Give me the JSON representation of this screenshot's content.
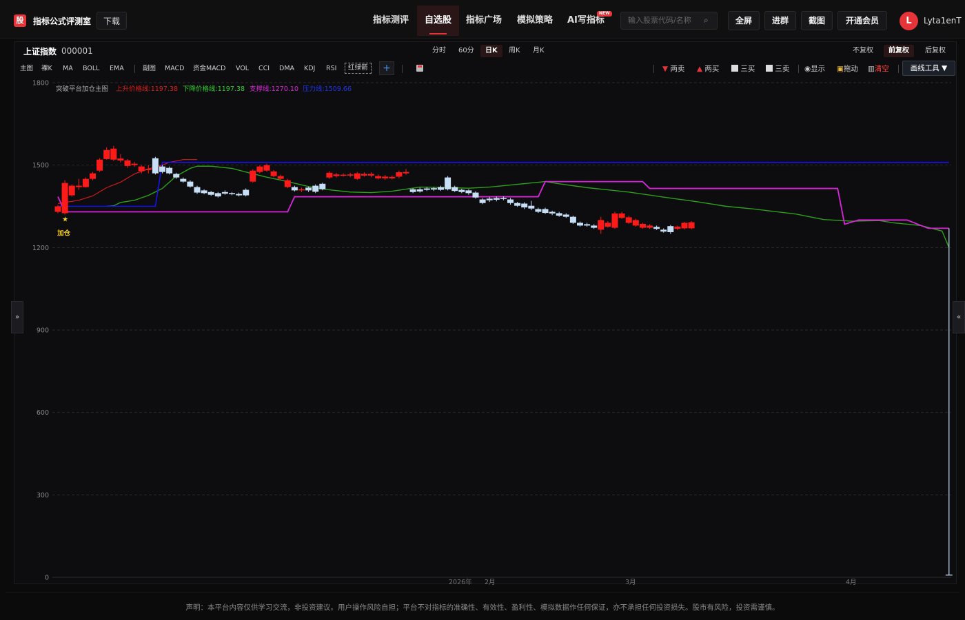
{
  "header": {
    "logo_char": "股",
    "logo_text": "指标公式评测室",
    "download_label": "下载",
    "nav": [
      {
        "label": "指标测评",
        "active": false
      },
      {
        "label": "自选股",
        "active": true
      },
      {
        "label": "指标广场",
        "active": false
      },
      {
        "label": "模拟策略",
        "active": false
      },
      {
        "label": "AI写指标",
        "active": false
      }
    ],
    "new_badge": "NEW",
    "search_placeholder": "输入股票代码/名称",
    "fullscreen_label": "全屏",
    "join_group_label": "进群",
    "screenshot_label": "截图",
    "vip_label": "开通会员",
    "avatar_letter": "L",
    "username": "Lyta1enT"
  },
  "stock": {
    "name": "上证指数",
    "code": "000001"
  },
  "periods": [
    {
      "label": "分时",
      "active": false
    },
    {
      "label": "60分",
      "active": false
    },
    {
      "label": "日K",
      "active": true
    },
    {
      "label": "周K",
      "active": false
    },
    {
      "label": "月K",
      "active": false
    }
  ],
  "adjust": [
    {
      "label": "不复权",
      "active": false
    },
    {
      "label": "前复权",
      "active": true
    },
    {
      "label": "后复权",
      "active": false
    }
  ],
  "indicators_main": [
    "主图",
    "裸K",
    "MA",
    "BOLL",
    "EMA"
  ],
  "indicators_sub": [
    "副图",
    "MACD",
    "资金MACD",
    "VOL",
    "CCI",
    "DMA",
    "KDJ",
    "RSI"
  ],
  "indicator_boxed": "红绿箭",
  "plus_label": "+",
  "tools": {
    "sell2": "两卖",
    "buy2": "两买",
    "buy3": "三买",
    "sell3": "三卖",
    "show": "显示",
    "drag": "拖动",
    "clear": "清空",
    "draw_tool": "画线工具 ▼"
  },
  "side_left": "»",
  "side_right": "«",
  "chart_data": {
    "type": "candlestick",
    "legend": {
      "name": "突破平台加仓主图",
      "up_price": "上升价格线:1197.38",
      "down_price": "下降价格线:1197.38",
      "support": "支撑线:1270.10",
      "pressure": "压力线:1509.66"
    },
    "y_ticks": [
      "1800",
      "1500",
      "1200",
      "900",
      "600",
      "300",
      "0"
    ],
    "ylim": [
      0,
      1800
    ],
    "x_labels": [
      "2026年",
      "2月",
      "3月",
      "4月"
    ],
    "annotation": {
      "label": "加仓",
      "star": "★",
      "index": 1
    },
    "colors": {
      "up": "#ff1a1a",
      "down": "#c7def7",
      "red_line": "#d21a1a",
      "green_line": "#2e9f1a",
      "blue_line": "#1414ee",
      "magenta_line": "#dd22dd",
      "grid": "#2a2a2c"
    },
    "candles": [
      {
        "o": 1330,
        "c": 1350,
        "h": 1355,
        "l": 1325
      },
      {
        "o": 1325,
        "c": 1435,
        "h": 1445,
        "l": 1320
      },
      {
        "o": 1390,
        "c": 1425,
        "h": 1430,
        "l": 1385
      },
      {
        "o": 1420,
        "c": 1425,
        "h": 1450,
        "l": 1410
      },
      {
        "o": 1420,
        "c": 1450,
        "h": 1455,
        "l": 1418
      },
      {
        "o": 1450,
        "c": 1470,
        "h": 1475,
        "l": 1445
      },
      {
        "o": 1480,
        "c": 1520,
        "h": 1525,
        "l": 1475
      },
      {
        "o": 1522,
        "c": 1555,
        "h": 1565,
        "l": 1520
      },
      {
        "o": 1520,
        "c": 1560,
        "h": 1570,
        "l": 1515
      },
      {
        "o": 1517,
        "c": 1524,
        "h": 1540,
        "l": 1510
      },
      {
        "o": 1497,
        "c": 1517,
        "h": 1522,
        "l": 1490
      },
      {
        "o": 1500,
        "c": 1505,
        "h": 1512,
        "l": 1494
      },
      {
        "o": 1478,
        "c": 1495,
        "h": 1500,
        "l": 1470
      },
      {
        "o": 1482,
        "c": 1486,
        "h": 1500,
        "l": 1470
      },
      {
        "o": 1525,
        "c": 1470,
        "h": 1530,
        "l": 1466
      },
      {
        "o": 1495,
        "c": 1475,
        "h": 1500,
        "l": 1470
      },
      {
        "o": 1490,
        "c": 1470,
        "h": 1495,
        "l": 1466
      },
      {
        "o": 1468,
        "c": 1455,
        "h": 1472,
        "l": 1450
      },
      {
        "o": 1450,
        "c": 1440,
        "h": 1455,
        "l": 1436
      },
      {
        "o": 1440,
        "c": 1422,
        "h": 1445,
        "l": 1418
      },
      {
        "o": 1420,
        "c": 1400,
        "h": 1425,
        "l": 1395
      },
      {
        "o": 1408,
        "c": 1398,
        "h": 1412,
        "l": 1394
      },
      {
        "o": 1402,
        "c": 1392,
        "h": 1406,
        "l": 1388
      },
      {
        "o": 1398,
        "c": 1386,
        "h": 1402,
        "l": 1382
      },
      {
        "o": 1402,
        "c": 1396,
        "h": 1408,
        "l": 1392
      },
      {
        "o": 1398,
        "c": 1394,
        "h": 1402,
        "l": 1390
      },
      {
        "o": 1395,
        "c": 1390,
        "h": 1400,
        "l": 1386
      },
      {
        "o": 1410,
        "c": 1390,
        "h": 1415,
        "l": 1386
      },
      {
        "o": 1440,
        "c": 1480,
        "h": 1485,
        "l": 1436
      },
      {
        "o": 1475,
        "c": 1495,
        "h": 1500,
        "l": 1470
      },
      {
        "o": 1480,
        "c": 1500,
        "h": 1505,
        "l": 1476
      },
      {
        "o": 1460,
        "c": 1477,
        "h": 1482,
        "l": 1456
      },
      {
        "o": 1450,
        "c": 1460,
        "h": 1465,
        "l": 1446
      },
      {
        "o": 1420,
        "c": 1445,
        "h": 1450,
        "l": 1416
      },
      {
        "o": 1420,
        "c": 1408,
        "h": 1425,
        "l": 1404
      },
      {
        "o": 1408,
        "c": 1412,
        "h": 1418,
        "l": 1402
      },
      {
        "o": 1418,
        "c": 1408,
        "h": 1422,
        "l": 1402
      },
      {
        "o": 1425,
        "c": 1403,
        "h": 1430,
        "l": 1398
      },
      {
        "o": 1432,
        "c": 1412,
        "h": 1436,
        "l": 1408
      },
      {
        "o": 1455,
        "c": 1472,
        "h": 1478,
        "l": 1450
      },
      {
        "o": 1460,
        "c": 1466,
        "h": 1472,
        "l": 1455
      },
      {
        "o": 1462,
        "c": 1465,
        "h": 1470,
        "l": 1458
      },
      {
        "o": 1462,
        "c": 1466,
        "h": 1472,
        "l": 1456
      },
      {
        "o": 1450,
        "c": 1470,
        "h": 1475,
        "l": 1446
      },
      {
        "o": 1462,
        "c": 1468,
        "h": 1474,
        "l": 1458
      },
      {
        "o": 1462,
        "c": 1468,
        "h": 1474,
        "l": 1456
      },
      {
        "o": 1452,
        "c": 1460,
        "h": 1466,
        "l": 1448
      },
      {
        "o": 1452,
        "c": 1458,
        "h": 1464,
        "l": 1446
      },
      {
        "o": 1452,
        "c": 1457,
        "h": 1462,
        "l": 1448
      },
      {
        "o": 1458,
        "c": 1474,
        "h": 1480,
        "l": 1452
      },
      {
        "o": 1470,
        "c": 1475,
        "h": 1486,
        "l": 1465
      },
      {
        "o": 1412,
        "c": 1402,
        "h": 1416,
        "l": 1398
      },
      {
        "o": 1412,
        "c": 1404,
        "h": 1418,
        "l": 1400
      },
      {
        "o": 1415,
        "c": 1410,
        "h": 1420,
        "l": 1406
      },
      {
        "o": 1416,
        "c": 1411,
        "h": 1420,
        "l": 1406
      },
      {
        "o": 1420,
        "c": 1410,
        "h": 1425,
        "l": 1406
      },
      {
        "o": 1455,
        "c": 1412,
        "h": 1460,
        "l": 1408
      },
      {
        "o": 1420,
        "c": 1406,
        "h": 1425,
        "l": 1402
      },
      {
        "o": 1410,
        "c": 1402,
        "h": 1414,
        "l": 1398
      },
      {
        "o": 1408,
        "c": 1398,
        "h": 1412,
        "l": 1392
      },
      {
        "o": 1400,
        "c": 1382,
        "h": 1405,
        "l": 1378
      },
      {
        "o": 1375,
        "c": 1362,
        "h": 1380,
        "l": 1358
      },
      {
        "o": 1378,
        "c": 1372,
        "h": 1384,
        "l": 1366
      },
      {
        "o": 1380,
        "c": 1374,
        "h": 1386,
        "l": 1368
      },
      {
        "o": 1380,
        "c": 1378,
        "h": 1386,
        "l": 1372
      },
      {
        "o": 1375,
        "c": 1362,
        "h": 1380,
        "l": 1356
      },
      {
        "o": 1362,
        "c": 1352,
        "h": 1366,
        "l": 1348
      },
      {
        "o": 1360,
        "c": 1346,
        "h": 1365,
        "l": 1340
      },
      {
        "o": 1352,
        "c": 1342,
        "h": 1370,
        "l": 1336
      },
      {
        "o": 1340,
        "c": 1330,
        "h": 1345,
        "l": 1326
      },
      {
        "o": 1340,
        "c": 1326,
        "h": 1345,
        "l": 1322
      },
      {
        "o": 1330,
        "c": 1324,
        "h": 1334,
        "l": 1318
      },
      {
        "o": 1325,
        "c": 1316,
        "h": 1330,
        "l": 1312
      },
      {
        "o": 1320,
        "c": 1312,
        "h": 1325,
        "l": 1308
      },
      {
        "o": 1312,
        "c": 1290,
        "h": 1316,
        "l": 1286
      },
      {
        "o": 1290,
        "c": 1280,
        "h": 1295,
        "l": 1276
      },
      {
        "o": 1285,
        "c": 1280,
        "h": 1290,
        "l": 1276
      },
      {
        "o": 1280,
        "c": 1272,
        "h": 1285,
        "l": 1268
      },
      {
        "o": 1265,
        "c": 1300,
        "h": 1312,
        "l": 1250
      },
      {
        "o": 1276,
        "c": 1290,
        "h": 1296,
        "l": 1272
      },
      {
        "o": 1272,
        "c": 1324,
        "h": 1330,
        "l": 1268
      },
      {
        "o": 1308,
        "c": 1324,
        "h": 1330,
        "l": 1304
      },
      {
        "o": 1290,
        "c": 1310,
        "h": 1316,
        "l": 1286
      },
      {
        "o": 1280,
        "c": 1300,
        "h": 1305,
        "l": 1276
      },
      {
        "o": 1272,
        "c": 1286,
        "h": 1290,
        "l": 1268
      },
      {
        "o": 1272,
        "c": 1280,
        "h": 1285,
        "l": 1268
      },
      {
        "o": 1275,
        "c": 1268,
        "h": 1280,
        "l": 1264
      },
      {
        "o": 1265,
        "c": 1258,
        "h": 1270,
        "l": 1254
      },
      {
        "o": 1278,
        "c": 1256,
        "h": 1282,
        "l": 1250
      },
      {
        "o": 1268,
        "c": 1276,
        "h": 1280,
        "l": 1264
      },
      {
        "o": 1270,
        "c": 1290,
        "h": 1294,
        "l": 1266
      },
      {
        "o": 1270,
        "c": 1292,
        "h": 1296,
        "l": 1266
      }
    ],
    "lines": {
      "red": [
        [
          0,
          1360
        ],
        [
          3,
          1372
        ],
        [
          5,
          1388
        ],
        [
          7,
          1418
        ],
        [
          9,
          1438
        ],
        [
          11,
          1468
        ],
        [
          13,
          1486
        ],
        [
          15,
          1500
        ],
        [
          16,
          1510
        ],
        [
          18,
          1520
        ],
        [
          20,
          1520
        ]
      ],
      "green": [
        [
          7,
          1350
        ],
        [
          8,
          1352
        ],
        [
          9,
          1364
        ],
        [
          11,
          1372
        ],
        [
          13,
          1390
        ],
        [
          15,
          1415
        ],
        [
          17,
          1460
        ],
        [
          19,
          1488
        ],
        [
          20,
          1496
        ],
        [
          22,
          1496
        ],
        [
          25,
          1488
        ],
        [
          27,
          1475
        ],
        [
          30,
          1456
        ],
        [
          33,
          1440
        ],
        [
          36,
          1422
        ],
        [
          39,
          1410
        ],
        [
          42,
          1402
        ],
        [
          45,
          1400
        ],
        [
          48,
          1405
        ],
        [
          52,
          1420
        ],
        [
          56,
          1418
        ],
        [
          59,
          1416
        ],
        [
          62,
          1420
        ],
        [
          66,
          1430
        ],
        [
          70,
          1440
        ],
        [
          72,
          1432
        ],
        [
          76,
          1418
        ],
        [
          82,
          1402
        ],
        [
          88,
          1380
        ],
        [
          92,
          1366
        ],
        [
          96,
          1350
        ],
        [
          100,
          1340
        ],
        [
          104,
          1328
        ],
        [
          106,
          1322
        ],
        [
          108,
          1312
        ],
        [
          110,
          1302
        ],
        [
          114,
          1296
        ],
        [
          118,
          1298
        ],
        [
          120,
          1290
        ],
        [
          124,
          1280
        ],
        [
          127,
          1260
        ],
        [
          128,
          1200
        ]
      ],
      "blue": [
        [
          0,
          1350
        ],
        [
          1,
          1350
        ],
        [
          3,
          1350
        ],
        [
          7,
          1350
        ],
        [
          10,
          1350
        ],
        [
          13,
          1350
        ],
        [
          14,
          1350
        ],
        [
          15,
          1510
        ],
        [
          16,
          1510
        ],
        [
          128,
          1510
        ]
      ],
      "magenta": [
        [
          0,
          1385
        ],
        [
          1,
          1330
        ],
        [
          3,
          1330
        ],
        [
          7,
          1330
        ],
        [
          10,
          1330
        ],
        [
          20,
          1330
        ],
        [
          33,
          1330
        ],
        [
          34,
          1385
        ],
        [
          36,
          1385
        ],
        [
          40,
          1385
        ],
        [
          55,
          1385
        ],
        [
          56,
          1385
        ],
        [
          60,
          1385
        ],
        [
          64,
          1385
        ],
        [
          69,
          1385
        ],
        [
          70,
          1440
        ],
        [
          75,
          1440
        ],
        [
          84,
          1440
        ],
        [
          85,
          1415
        ],
        [
          90,
          1415
        ],
        [
          100,
          1415
        ],
        [
          112,
          1415
        ],
        [
          113,
          1285
        ],
        [
          115,
          1300
        ],
        [
          118,
          1300
        ],
        [
          122,
          1300
        ],
        [
          125,
          1270
        ],
        [
          127,
          1270
        ],
        [
          128,
          1270
        ]
      ],
      "tail": [
        [
          128,
          1270
        ],
        [
          128,
          8
        ]
      ]
    }
  },
  "disclaimer": "声明：本平台内容仅供学习交流，非投资建议。用户操作风险自担；平台不对指标的准确性、有效性、盈利性、模拟数据作任何保证，亦不承担任何投资损失。股市有风险，投资需谨慎。"
}
